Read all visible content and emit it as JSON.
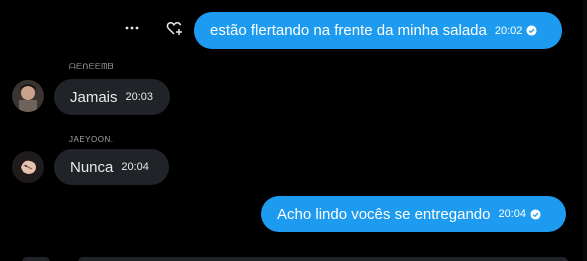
{
  "messages": [
    {
      "direction": "out",
      "text": "estão flertando na frente da minha salada",
      "time": "20:02"
    },
    {
      "direction": "in",
      "sender": "ᗩᗴᑎᗴᗴᗰᗷ",
      "text": "Jamais",
      "time": "20:03"
    },
    {
      "direction": "in",
      "sender": "JAEYOON.",
      "text": "Nunca",
      "time": "20:04"
    },
    {
      "direction": "out",
      "text": "Acho lindo vocês se entregando",
      "time": "20:04"
    }
  ],
  "actions": {
    "more_icon": "more-horizontal-icon",
    "react_icon": "heart-plus-icon"
  },
  "colors": {
    "background": "#000000",
    "outgoing": "#1d9bf0",
    "incoming": "#202327",
    "text": "#e7e9ea"
  }
}
